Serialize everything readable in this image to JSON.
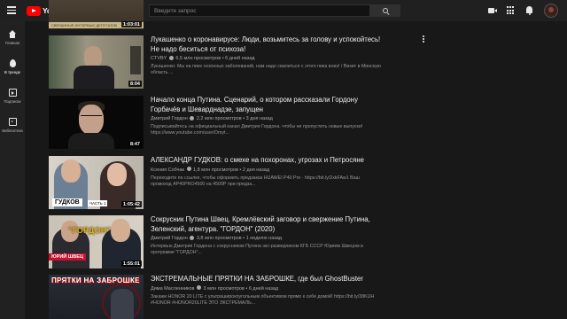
{
  "header": {
    "logo_text": "YouTube",
    "logo_region": "UA",
    "search_placeholder": "Введите запрос"
  },
  "sidebar": {
    "items": [
      {
        "label": "Главная",
        "icon": "home-icon"
      },
      {
        "label": "В тренде",
        "icon": "trending-icon"
      },
      {
        "label": "Подписки",
        "icon": "subscriptions-icon"
      },
      {
        "label": "Библиотека",
        "icon": "library-icon"
      }
    ]
  },
  "videos": [
    {
      "thumb_caption": "СВЯЗАННЫЕ ИНТЕРВЬЮ ДЕПУТАТОВ",
      "duration": "1:03:01"
    },
    {
      "title": "Лукашенко о коронавирусе: Люди, возьмитесь за голову и успокойтесь! Не надо беситься от психоза!",
      "channel": "CTVBY",
      "views": "6,5 млн просмотров",
      "age": "6 дней назад",
      "description": "Лукашенко: Мы на пике сезонных заболеваний, нам надо свалиться с этого пика вниз! / Визит в Минскую область ...",
      "duration": "8:04"
    },
    {
      "title": "Начало конца Путина. Сценарий, о котором рассказали Гордону Горбачёв и Шеварднадзе, запущен",
      "channel": "Дмитрий Гордон",
      "views": "2,2 млн просмотров",
      "age": "3 дня назад",
      "description": "Подписывайтесь на официальный канал Дмитрия Гордона, чтобы не пропустить новые выпуски! https://www.youtube.com/user/Dmyt...",
      "duration": "8:47"
    },
    {
      "title": "АЛЕКСАНДР ГУДКОВ: о смехе на похоронах, угрозах и Петросяне",
      "channel": "Ксения Собчак",
      "views": "1,8 млн просмотров",
      "age": "2 дня назад",
      "description": "Переходите по ссылке, чтобы оформить предзаказ HUAWEI P40 Pro · https://bit.ly/2xkFAw1 Ваш промокод AP40PRO4500 на 4500Р при предза...",
      "duration": "1:05:42",
      "thumb_label": "ГУДКОВ",
      "thumb_sublabel": "ЧАСТЬ 1"
    },
    {
      "title": "Сокрусник Путина Швец. Кремлёвский заговор и свержение Путина, Зеленский, агентура. \"ГОРДОН\" (2020)",
      "channel": "Дмитрий Гордон",
      "views": "3,8 млн просмотров",
      "age": "1 неделю назад",
      "description": "Интервью Дмитрия Гордона с сокрусником Путина экс-разведчиком КГБ СССР Юрием Швецом в программе \"ГОРДОН\"...",
      "duration": "1:55:01",
      "thumb_label": "\"ГОРДОН\"",
      "thumb_sublabel": "ЮРИЙ ШВЕЦ"
    },
    {
      "title": "ЭКСТРЕМАЛЬНЫЕ ПРЯТКИ НА ЗАБРОШКЕ, где был GhostBuster",
      "channel": "Дима Масленников",
      "views": "3 млн просмотров",
      "age": "6 дней назад",
      "description": "Закажи HONOR 20 LITE с ультраширокоугольным объективом прямо к себе домой! https://bit.ly/38KlJH #HONOR #HONOR20LITE ЭТО ЭКСТРЕМАЛЬ...",
      "thumb_label": "ПРЯТКИ НА ЗАБРОШКЕ"
    }
  ]
}
